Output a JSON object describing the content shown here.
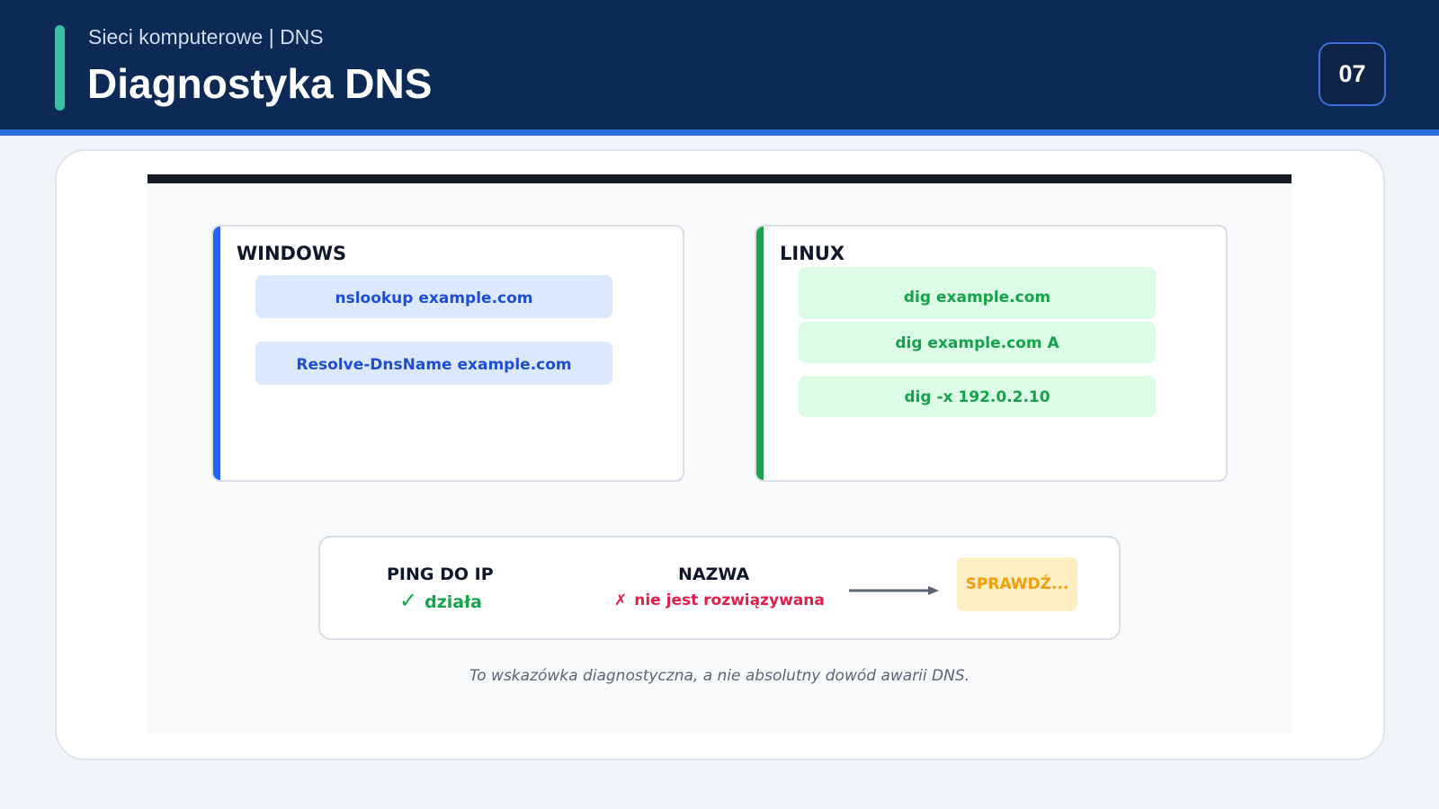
{
  "header": {
    "subtitle": "Sieci komputerowe | DNS",
    "title": "Diagnostyka DNS",
    "page_number": "07"
  },
  "colors": {
    "header_bg": "#0c2a55",
    "header_accent": "#34c3a0",
    "header_rule": "#2f6fe0",
    "windows_accent": "#2563eb",
    "linux_accent": "#16a34a",
    "error": "#e11d48",
    "warning": "#f59e0b"
  },
  "windows": {
    "title": "WINDOWS",
    "commands": [
      "nslookup example.com",
      "Resolve-DnsName example.com"
    ]
  },
  "linux": {
    "title": "LINUX",
    "commands": [
      "dig example.com",
      "dig example.com A",
      "dig -x 192.0.2.10"
    ]
  },
  "flow": {
    "ping_label": "PING DO IP",
    "ping_status_icon": "✓",
    "ping_status": "działa",
    "name_label": "NAZWA",
    "name_status_icon": "✗",
    "name_status": "nie jest rozwiązywana",
    "arrow_icon": "arrow-right-icon",
    "action": "SPRAWDŹ..."
  },
  "note": "To wskazówka diagnostyczna, a nie absolutny dowód awarii DNS."
}
